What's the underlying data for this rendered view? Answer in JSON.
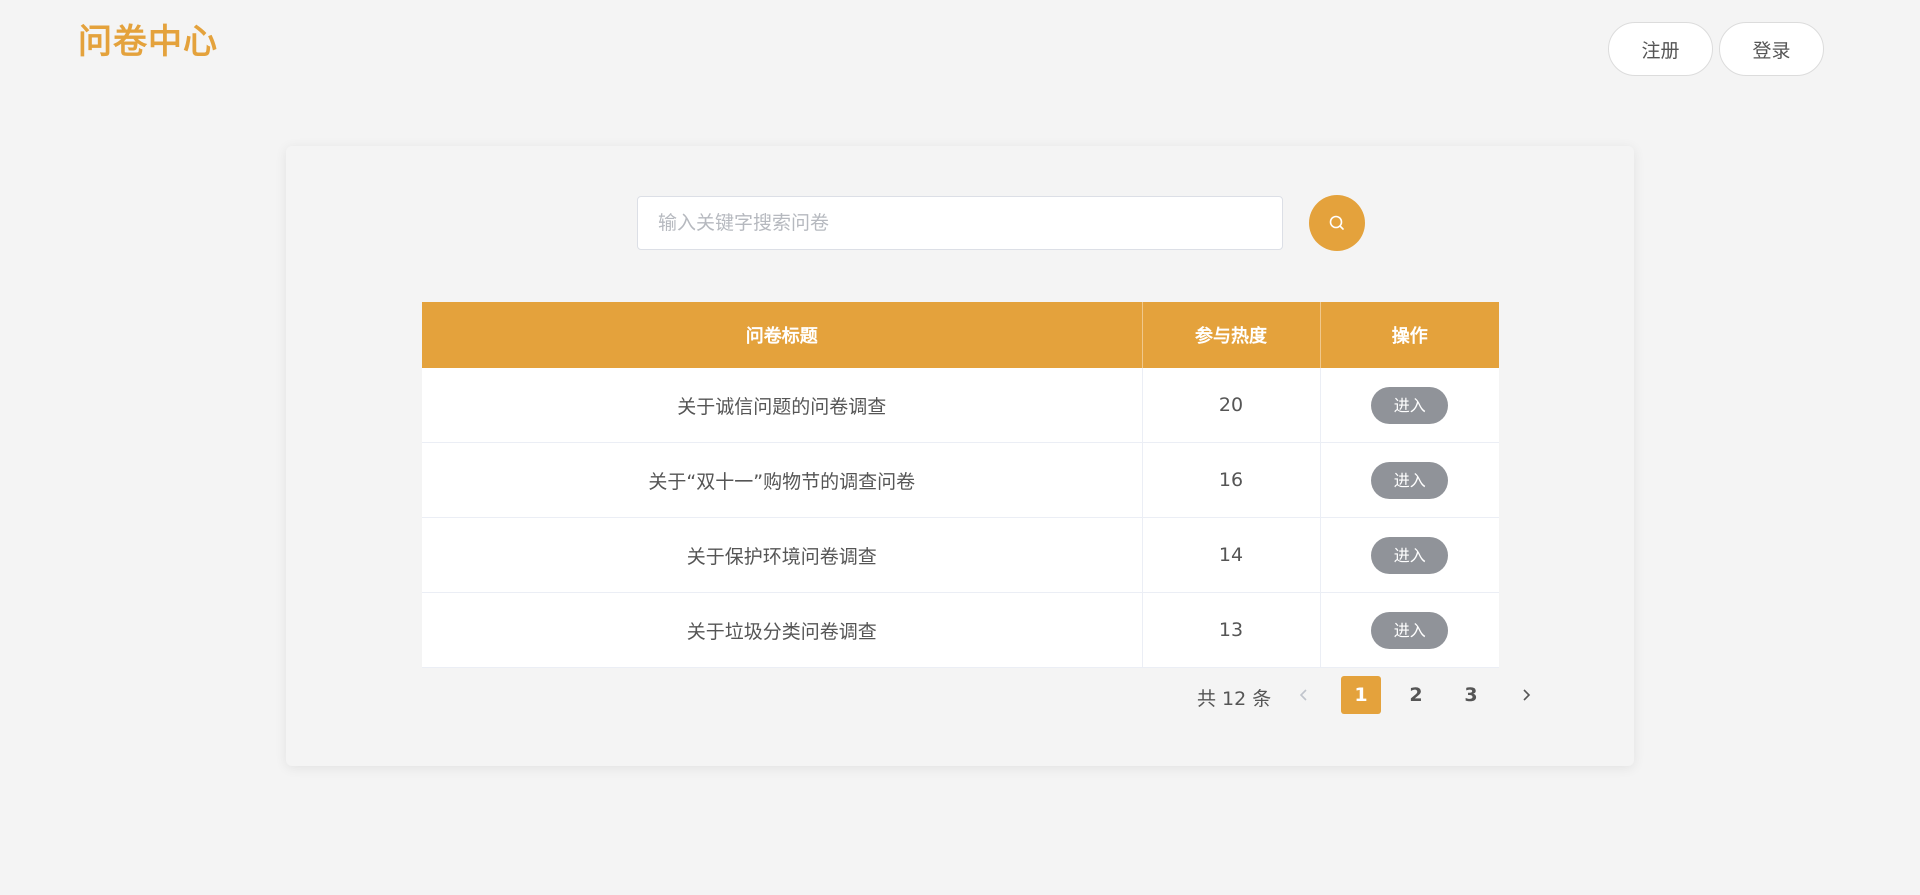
{
  "header": {
    "logo": "问卷中心",
    "register_label": "注册",
    "login_label": "登录"
  },
  "search": {
    "placeholder": "输入关键字搜索问卷",
    "value": "",
    "button_icon": "search-icon"
  },
  "table": {
    "columns": [
      "问卷标题",
      "参与热度",
      "操作"
    ],
    "rows": [
      {
        "title": "关于诚信问题的问卷调查",
        "heat": "20",
        "action": "进入"
      },
      {
        "title": "关于“双十一”购物节的调查问卷",
        "heat": "16",
        "action": "进入"
      },
      {
        "title": "关于保护环境问卷调查",
        "heat": "14",
        "action": "进入"
      },
      {
        "title": "关于垃圾分类问卷调查",
        "heat": "13",
        "action": "进入"
      }
    ]
  },
  "pagination": {
    "total_label": "共 12 条",
    "pages": [
      "1",
      "2",
      "3"
    ],
    "current_page": "1",
    "prev_icon": "chevron-left-icon",
    "next_icon": "chevron-right-icon"
  },
  "colors": {
    "accent": "#e4a23c",
    "enter_button": "#909399",
    "background": "#f4f4f4"
  }
}
